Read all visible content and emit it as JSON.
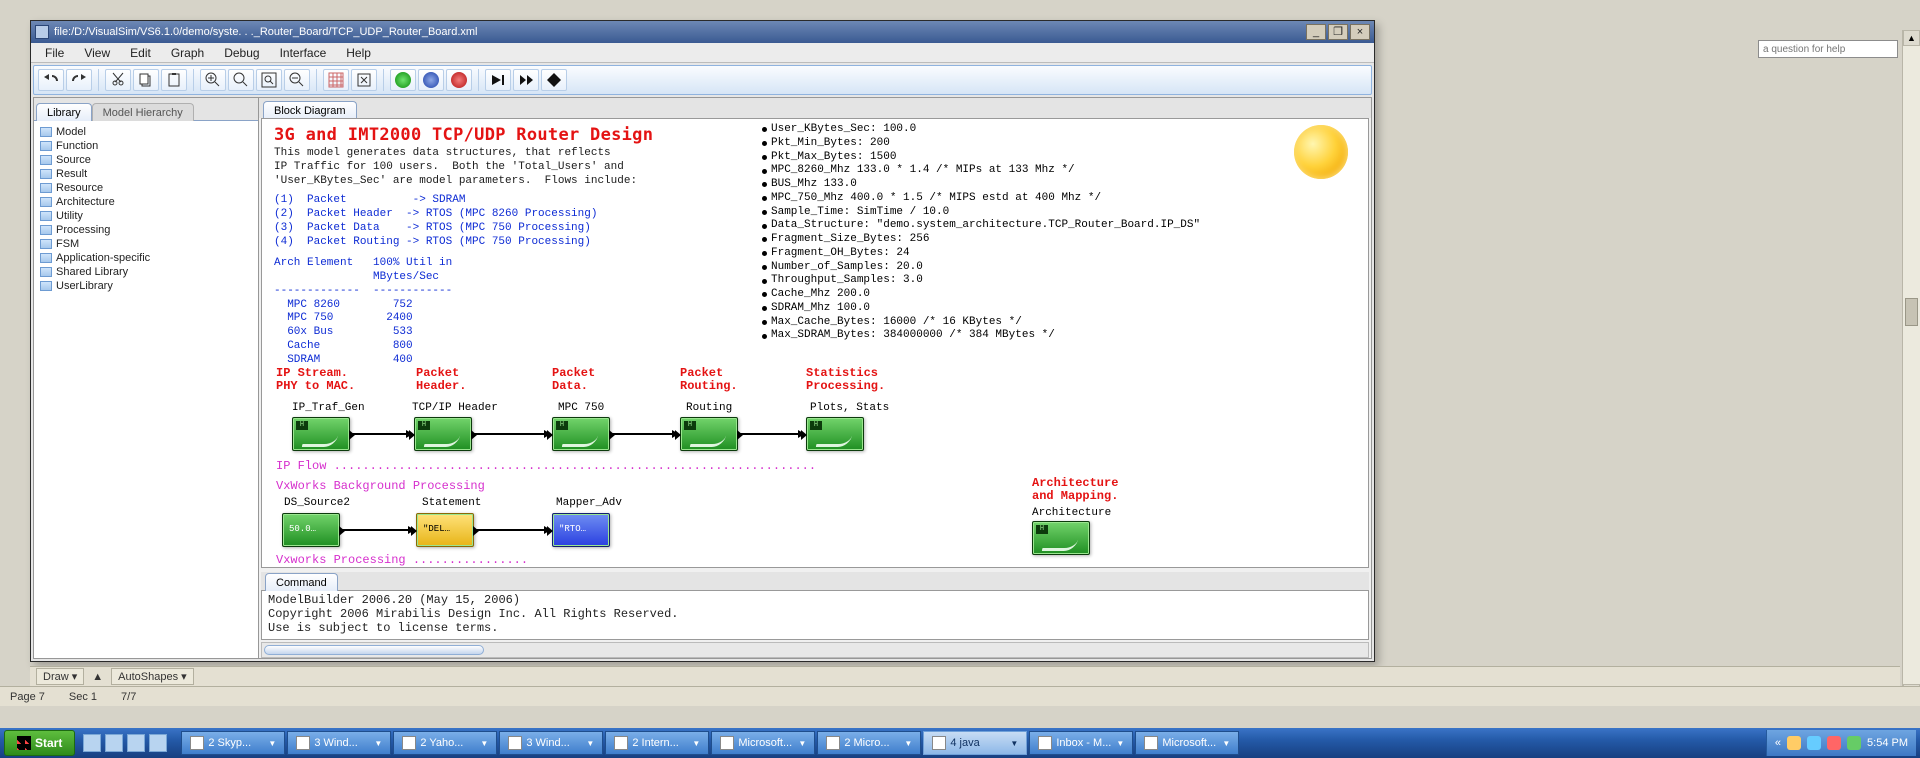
{
  "host": {
    "ask_help_placeholder": "a question for help",
    "draw": {
      "draw": "Draw ▾",
      "autoshapes": "AutoShapes ▾"
    },
    "status": {
      "page": "Page 7",
      "section": "Sec 1",
      "pages": "7/7"
    }
  },
  "taskbar": {
    "start": "Start",
    "items": [
      {
        "label": "2 Skyp..."
      },
      {
        "label": "3 Wind..."
      },
      {
        "label": "2 Yaho..."
      },
      {
        "label": "3 Wind..."
      },
      {
        "label": "2 Intern..."
      },
      {
        "label": "Microsoft..."
      },
      {
        "label": "2 Micro..."
      },
      {
        "label": "4 java",
        "active": true
      },
      {
        "label": "Inbox - M..."
      },
      {
        "label": "Microsoft..."
      }
    ],
    "clock": "5:54 PM",
    "tray_ext": "«"
  },
  "app": {
    "title": "file:/D:/VisualSim/VS6.1.0/demo/syste. . ._Router_Board/TCP_UDP_Router_Board.xml",
    "menus": [
      "File",
      "View",
      "Edit",
      "Graph",
      "Debug",
      "Interface",
      "Help"
    ],
    "left_tabs": {
      "library": "Library",
      "hierarchy": "Model Hierarchy"
    },
    "tree": [
      "Model",
      "Function",
      "Source",
      "Result",
      "Resource",
      "Architecture",
      "Utility",
      "Processing",
      "FSM",
      "Application-specific",
      "Shared Library",
      "UserLibrary"
    ],
    "bd_tab": "Block Diagram",
    "cmd_tab": "Command",
    "cmd_text": "ModelBuilder 2006.20 (May 15, 2006)\nCopyright 2006 Mirabilis Design Inc. All Rights Reserved.\nUse is subject to license terms."
  },
  "canvas": {
    "title": "3G and IMT2000 TCP/UDP Router Design",
    "subtitle": "This model generates data structures, that reflects\nIP Traffic for 100 users.  Both the 'Total_Users' and\n'User_KBytes_Sec' are model parameters.  Flows include:",
    "flows": "(1)  Packet          -> SDRAM\n(2)  Packet Header  -> RTOS (MPC 8260 Processing)\n(3)  Packet Data    -> RTOS (MPC 750 Processing)\n(4)  Packet Routing -> RTOS (MPC 750 Processing)",
    "arch_header": "Arch Element   100% Util in\n               MBytes/Sec\n-------------  ------------",
    "arch_rows": "  MPC 8260        752\n  MPC 750        2400\n  60x Bus         533\n  Cache           800\n  SDRAM           400",
    "params": [
      "User_KBytes_Sec: 100.0",
      "Pkt_Min_Bytes: 200",
      "Pkt_Max_Bytes: 1500",
      "MPC_8260_Mhz 133.0 * 1.4 /* MIPs at 133 Mhz */",
      "BUS_Mhz 133.0",
      "MPC_750_Mhz 400.0 * 1.5 /* MIPS estd at 400 Mhz */",
      "Sample_Time: SimTime / 10.0",
      "Data_Structure: \"demo.system_architecture.TCP_Router_Board.IP_DS\"",
      "Fragment_Size_Bytes: 256",
      "Fragment_OH_Bytes: 24",
      "Number_of_Samples: 20.0",
      "Throughput_Samples: 3.0",
      "Cache_Mhz 200.0",
      "SDRAM_Mhz 100.0",
      "Max_Cache_Bytes: 16000 /* 16 KBytes */",
      "Max_SDRAM_Bytes: 384000000 /* 384 MBytes */"
    ],
    "sections": {
      "s1": "IP Stream.\nPHY to MAC.",
      "s2": "Packet\nHeader.",
      "s3": "Packet\nData.",
      "s4": "Packet\nRouting.",
      "s5": "Statistics\nProcessing.",
      "s6": "Architecture\nand Mapping."
    },
    "block_labels": {
      "b1": "IP_Traf_Gen",
      "b2": "TCP/IP Header",
      "b3": "MPC 750",
      "b4": "Routing",
      "b5": "Plots, Stats",
      "b6": "DS_Source2",
      "b7": "Statement",
      "b8": "Mapper_Adv",
      "b9": "Architecture"
    },
    "block_inner": {
      "b6": "50.0…",
      "b7": "\"DEL…",
      "b8": "\"RTO…"
    },
    "ipflow": "IP Flow ...................................................................",
    "vxbg": "VxWorks Background Processing",
    "vxproc": "Vxworks Processing ................"
  }
}
